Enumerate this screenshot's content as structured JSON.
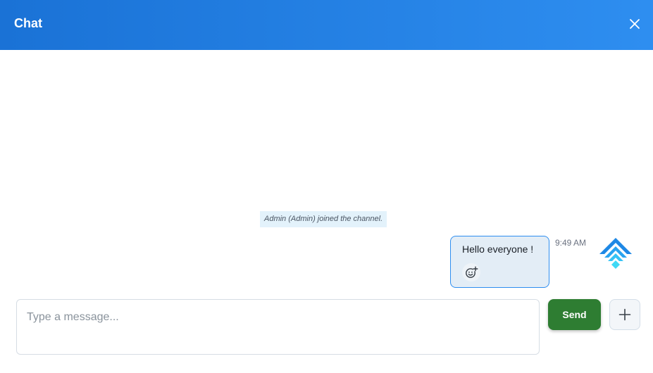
{
  "header": {
    "title": "Chat",
    "close_icon": "close-icon"
  },
  "colors": {
    "header_start": "#1a72d6",
    "header_end": "#2e8ef0",
    "bubble_bg": "#e3edf6",
    "bubble_border": "#2e8ef0",
    "send_button": "#2e7d32",
    "system_note_bg": "#e3f2fb"
  },
  "messages": {
    "system_note": "Admin (Admin) joined the channel.",
    "items": [
      {
        "text": "Hello everyone !",
        "time": "9:49 AM",
        "reaction_icon": "add-reaction-icon",
        "avatar_icon": "chevron-stack-logo-icon"
      }
    ]
  },
  "composer": {
    "placeholder": "Type a message...",
    "value": "",
    "send_label": "Send",
    "add_icon": "plus-icon"
  }
}
